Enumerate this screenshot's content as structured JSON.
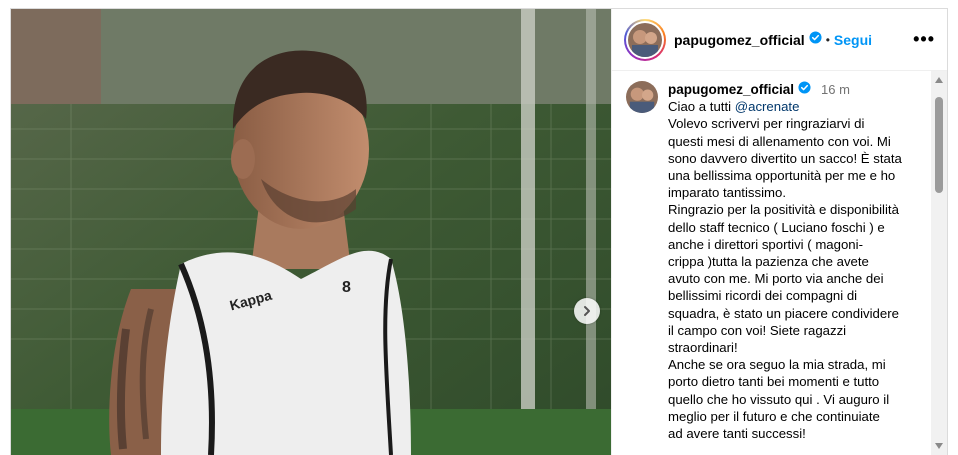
{
  "post": {
    "username": "papugomez_official",
    "follow_label": "Segui",
    "more_label": "•••",
    "time_ago": "16 m"
  },
  "caption": {
    "greeting": "Ciao a tutti ",
    "mention": "@acrenate",
    "lines": [
      "Volevo scrivervi per ringraziarvi di",
      "questi mesi di allenamento con voi. Mi",
      "sono davvero divertito un sacco! È stata",
      "una bellissima opportunità per me e ho",
      "imparato tantissimo.",
      "Ringrazio per la positività e disponibilità",
      "dello staff tecnico ( Luciano foschi ) e",
      "anche i direttori sportivi ( magoni-",
      "crippa )tutta la pazienza che avete",
      "avuto con me. Mi porto via anche dei",
      "bellissimi ricordi dei compagni di",
      "squadra, è stato un piacere condividere",
      "il campo con voi! Siete ragazzi",
      "straordinari!",
      "Anche se ora seguo la mia strada, mi",
      "porto dietro tanti bei momenti e tutto",
      "quello che ho vissuto qui . Vi auguro il",
      "meglio per il futuro e che continuiate",
      "ad avere tanti successi!"
    ]
  },
  "photo": {
    "shirt_brand": "Kappa",
    "shirt_number": "8"
  },
  "colors": {
    "link_blue": "#0095f6",
    "mention_blue": "#00376b",
    "verified_blue": "#0095f6",
    "muted": "#737373"
  }
}
